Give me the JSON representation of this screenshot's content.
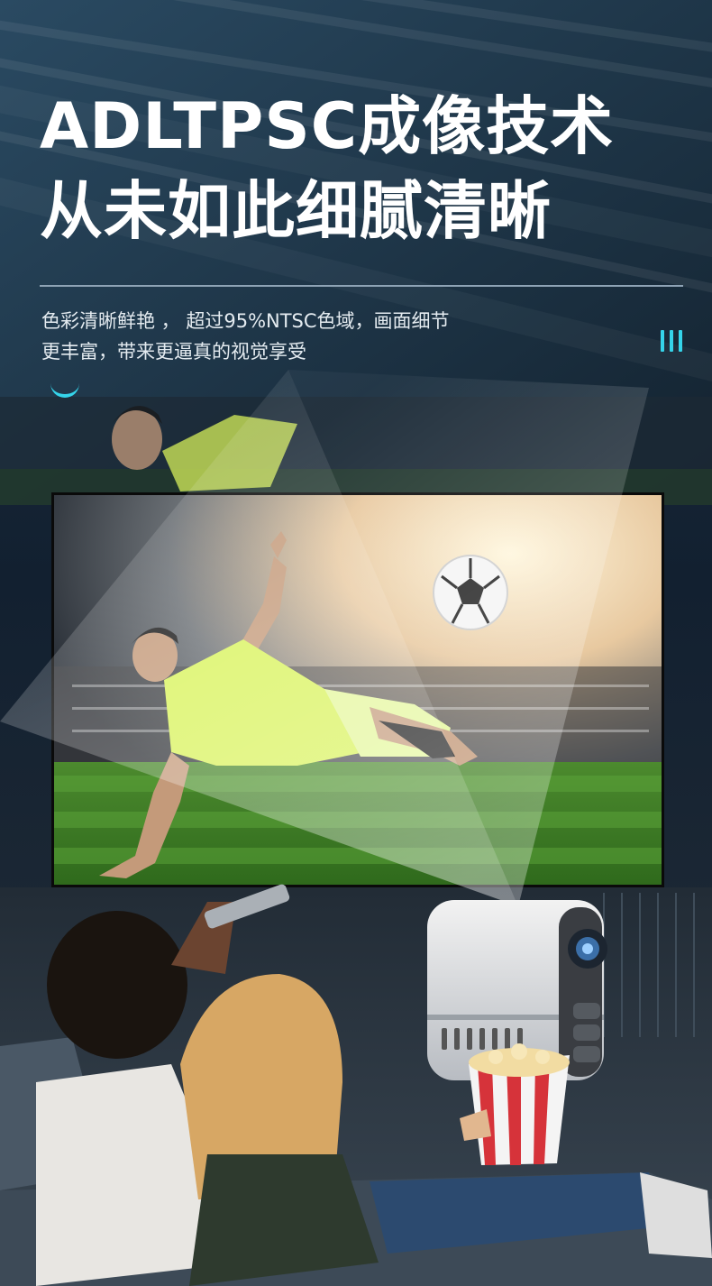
{
  "headline": {
    "line1": "ADLTPSC成像技术",
    "line2": "从未如此细腻清晰"
  },
  "subtitle": {
    "line1": "色彩清晰鲜艳 ， 超过95%NTSC色域，画面细节",
    "line2": "更丰富，带来更逼真的视觉享受"
  },
  "colors": {
    "accent": "#35d4ea",
    "headline": "#ffffff",
    "background": "#17283a"
  },
  "icons": [
    "three-bars-icon",
    "arc-icon",
    "soccer-ball-icon"
  ],
  "scene": {
    "screen_content": "soccer-player-bicycle-kick",
    "foreground": "couple-on-sofa-with-remote-and-popcorn",
    "device": "mini-projector"
  }
}
